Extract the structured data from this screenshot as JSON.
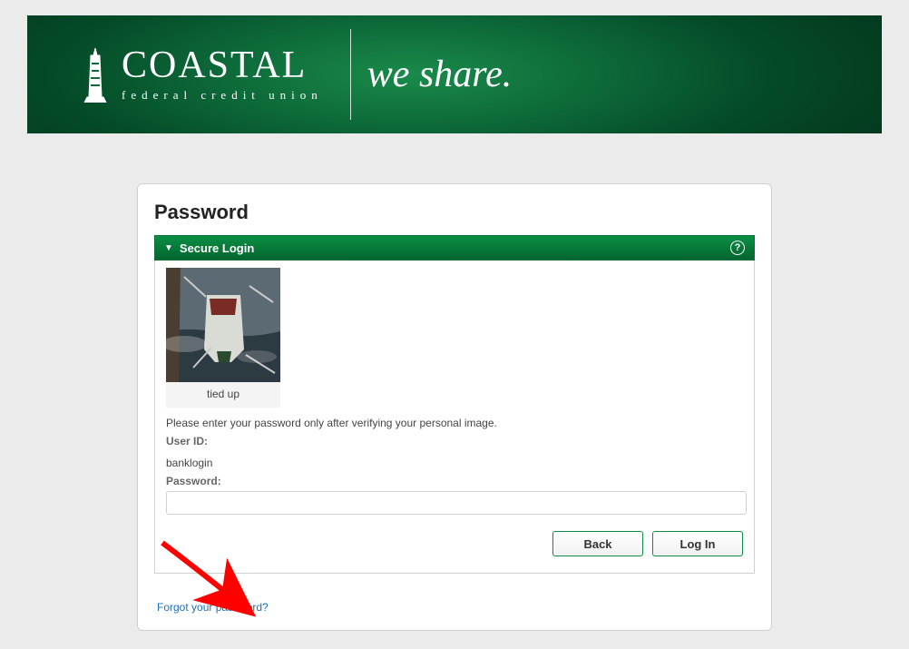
{
  "banner": {
    "brand": "COASTAL",
    "subtitle": "federal credit union",
    "tagline": "we share."
  },
  "card": {
    "title": "Password",
    "panel_title": "Secure Login",
    "security_image_caption": "tied up",
    "instruction": "Please enter your password only after verifying your personal image.",
    "user_id_label": "User ID:",
    "user_id_value": "banklogin",
    "password_label": "Password:",
    "password_value": "",
    "buttons": {
      "back": "Back",
      "login": "Log In"
    },
    "forgot_link": "Forgot your password?"
  }
}
